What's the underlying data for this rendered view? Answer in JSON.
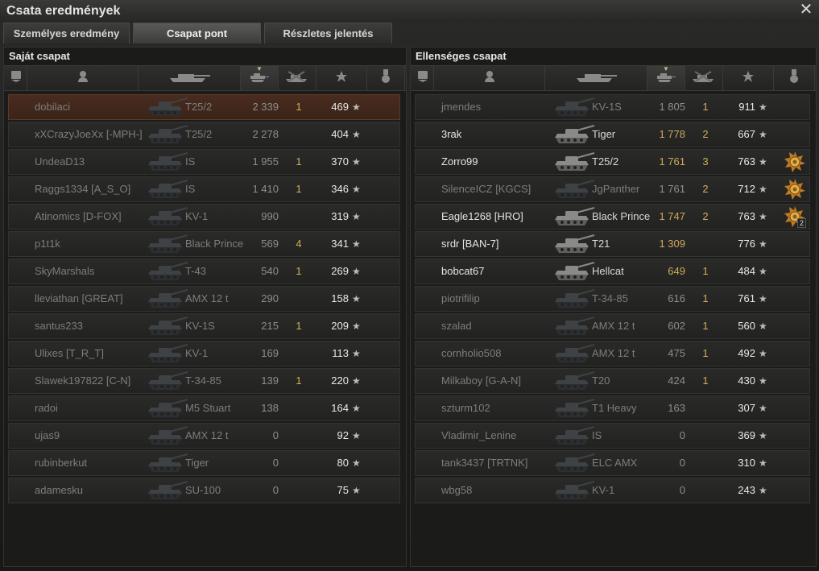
{
  "window": {
    "title": "Csata eredmények"
  },
  "tabs": [
    {
      "label": "Személyes eredmény",
      "active": false
    },
    {
      "label": "Csapat pont",
      "active": true
    },
    {
      "label": "Részletes jelentés",
      "active": false
    }
  ],
  "columns": {
    "icons": [
      "squad-icon",
      "player-icon",
      "tank-icon",
      "damage-icon",
      "frags-icon",
      "xp-star-icon",
      "medal-icon"
    ],
    "sorted": "damage"
  },
  "own_team": {
    "title": "Saját csapat",
    "rows": [
      {
        "player": "dobilaci",
        "tank": "T25/2",
        "damage": "2 339",
        "frags": "1",
        "xp": "469",
        "alive": false,
        "self": true
      },
      {
        "player": "xXCrazyJoeXx [-MPH-]",
        "tank": "T25/2",
        "damage": "2 278",
        "frags": "",
        "xp": "404",
        "alive": false
      },
      {
        "player": "UndeaD13",
        "tank": "IS",
        "damage": "1 955",
        "frags": "1",
        "xp": "370",
        "alive": false
      },
      {
        "player": "Raggs1334 [A_S_O]",
        "tank": "IS",
        "damage": "1 410",
        "frags": "1",
        "xp": "346",
        "alive": false
      },
      {
        "player": "Atinomics [D-FOX]",
        "tank": "KV-1",
        "damage": "990",
        "frags": "",
        "xp": "319",
        "alive": false
      },
      {
        "player": "p1t1k",
        "tank": "Black Prince",
        "damage": "569",
        "frags": "4",
        "xp": "341",
        "alive": false
      },
      {
        "player": "SkyMarshals",
        "tank": "T-43",
        "damage": "540",
        "frags": "1",
        "xp": "269",
        "alive": false
      },
      {
        "player": "lleviathan [GREAT]",
        "tank": "AMX 12 t",
        "damage": "290",
        "frags": "",
        "xp": "158",
        "alive": false
      },
      {
        "player": "santus233",
        "tank": "KV-1S",
        "damage": "215",
        "frags": "1",
        "xp": "209",
        "alive": false
      },
      {
        "player": "Ulixes [T_R_T]",
        "tank": "KV-1",
        "damage": "169",
        "frags": "",
        "xp": "113",
        "alive": false
      },
      {
        "player": "Slawek197822 [C-N]",
        "tank": "T-34-85",
        "damage": "139",
        "frags": "1",
        "xp": "220",
        "alive": false
      },
      {
        "player": "radoi",
        "tank": "M5 Stuart",
        "damage": "138",
        "frags": "",
        "xp": "164",
        "alive": false
      },
      {
        "player": "ujas9",
        "tank": "AMX 12 t",
        "damage": "0",
        "frags": "",
        "xp": "92",
        "alive": false
      },
      {
        "player": "rubinberkut",
        "tank": "Tiger",
        "damage": "0",
        "frags": "",
        "xp": "80",
        "alive": false
      },
      {
        "player": "adamesku",
        "tank": "SU-100",
        "damage": "0",
        "frags": "",
        "xp": "75",
        "alive": false
      }
    ]
  },
  "enemy_team": {
    "title": "Ellenséges csapat",
    "rows": [
      {
        "player": "jmendes",
        "tank": "KV-1S",
        "damage": "1 805",
        "frags": "1",
        "xp": "911",
        "alive": false
      },
      {
        "player": "3rak",
        "tank": "Tiger",
        "damage": "1 778",
        "frags": "2",
        "xp": "667",
        "alive": true
      },
      {
        "player": "Zorro99",
        "tank": "T25/2",
        "damage": "1 761",
        "frags": "3",
        "xp": "763",
        "alive": true,
        "medal": "medal-icon"
      },
      {
        "player": "SilenceICZ [KGCS]",
        "tank": "JgPanther",
        "damage": "1 761",
        "frags": "2",
        "xp": "712",
        "alive": false,
        "medal": "medal-icon"
      },
      {
        "player": "Eagle1268 [HRO]",
        "tank": "Black Prince",
        "damage": "1 747",
        "frags": "2",
        "xp": "763",
        "alive": true,
        "medal": "medal-icon",
        "medal_count": "2"
      },
      {
        "player": "srdr [BAN-7]",
        "tank": "T21",
        "damage": "1 309",
        "frags": "",
        "xp": "776",
        "alive": true
      },
      {
        "player": "bobcat67",
        "tank": "Hellcat",
        "damage": "649",
        "frags": "1",
        "xp": "484",
        "alive": true
      },
      {
        "player": "piotrifilip",
        "tank": "T-34-85",
        "damage": "616",
        "frags": "1",
        "xp": "761",
        "alive": false
      },
      {
        "player": "szalad",
        "tank": "AMX 12 t",
        "damage": "602",
        "frags": "1",
        "xp": "560",
        "alive": false
      },
      {
        "player": "cornholio508",
        "tank": "AMX 12 t",
        "damage": "475",
        "frags": "1",
        "xp": "492",
        "alive": false
      },
      {
        "player": "Milkaboy [G-A-N]",
        "tank": "T20",
        "damage": "424",
        "frags": "1",
        "xp": "430",
        "alive": false
      },
      {
        "player": "szturm102",
        "tank": "T1 Heavy",
        "damage": "163",
        "frags": "",
        "xp": "307",
        "alive": false
      },
      {
        "player": "Vladimir_Lenine",
        "tank": "IS",
        "damage": "0",
        "frags": "",
        "xp": "369",
        "alive": false
      },
      {
        "player": "tank3437 [TRTNK]",
        "tank": "ELC AMX",
        "damage": "0",
        "frags": "",
        "xp": "310",
        "alive": false
      },
      {
        "player": "wbg58",
        "tank": "KV-1",
        "damage": "0",
        "frags": "",
        "xp": "243",
        "alive": false
      }
    ]
  }
}
